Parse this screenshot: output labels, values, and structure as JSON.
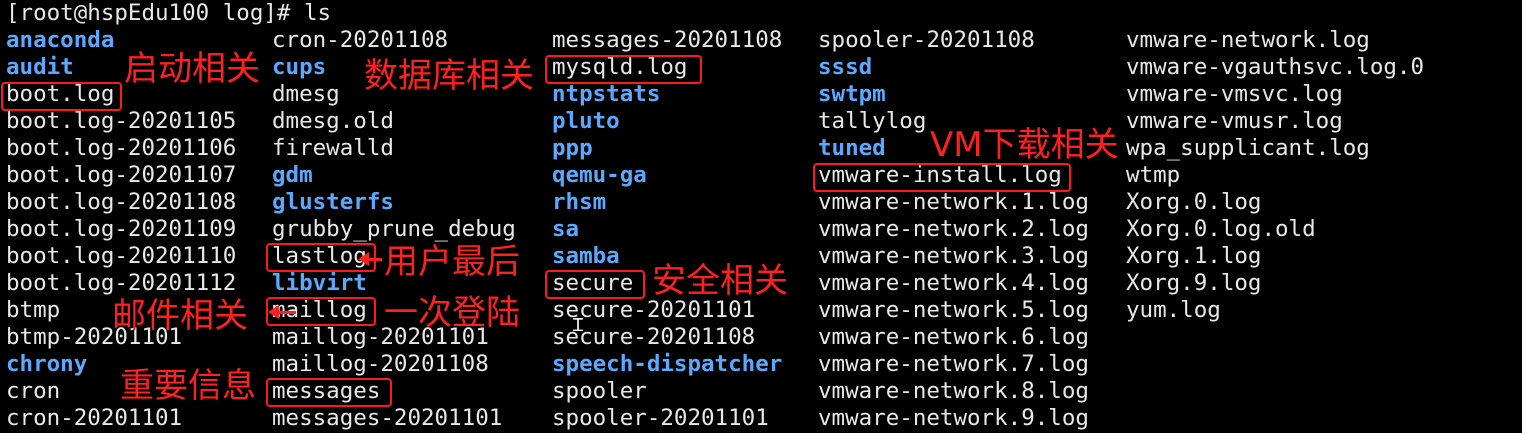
{
  "terminal": {
    "prompt": "[root@hspEdu100 log]# ls",
    "columns": [
      {
        "entries": [
          {
            "name": "anaconda",
            "type": "dir"
          },
          {
            "name": "audit",
            "type": "dir"
          },
          {
            "name": "boot.log",
            "type": "file"
          },
          {
            "name": "boot.log-20201105",
            "type": "file"
          },
          {
            "name": "boot.log-20201106",
            "type": "file"
          },
          {
            "name": "boot.log-20201107",
            "type": "file"
          },
          {
            "name": "boot.log-20201108",
            "type": "file"
          },
          {
            "name": "boot.log-20201109",
            "type": "file"
          },
          {
            "name": "boot.log-20201110",
            "type": "file"
          },
          {
            "name": "boot.log-20201112",
            "type": "file"
          },
          {
            "name": "btmp",
            "type": "file"
          },
          {
            "name": "btmp-20201101",
            "type": "file"
          },
          {
            "name": "chrony",
            "type": "dir"
          },
          {
            "name": "cron",
            "type": "file"
          },
          {
            "name": "cron-20201101",
            "type": "file"
          }
        ]
      },
      {
        "entries": [
          {
            "name": "cron-20201108",
            "type": "file"
          },
          {
            "name": "cups",
            "type": "dir"
          },
          {
            "name": "dmesg",
            "type": "file"
          },
          {
            "name": "dmesg.old",
            "type": "file"
          },
          {
            "name": "firewalld",
            "type": "file"
          },
          {
            "name": "gdm",
            "type": "dir"
          },
          {
            "name": "glusterfs",
            "type": "dir"
          },
          {
            "name": "grubby_prune_debug",
            "type": "file"
          },
          {
            "name": "lastlog",
            "type": "file"
          },
          {
            "name": "libvirt",
            "type": "dir"
          },
          {
            "name": "maillog",
            "type": "file"
          },
          {
            "name": "maillog-20201101",
            "type": "file"
          },
          {
            "name": "maillog-20201108",
            "type": "file"
          },
          {
            "name": "messages",
            "type": "file"
          },
          {
            "name": "messages-20201101",
            "type": "file"
          }
        ]
      },
      {
        "entries": [
          {
            "name": "messages-20201108",
            "type": "file"
          },
          {
            "name": "mysqld.log",
            "type": "file"
          },
          {
            "name": "ntpstats",
            "type": "dir"
          },
          {
            "name": "pluto",
            "type": "dir"
          },
          {
            "name": "ppp",
            "type": "dir"
          },
          {
            "name": "qemu-ga",
            "type": "dir"
          },
          {
            "name": "rhsm",
            "type": "dir"
          },
          {
            "name": "sa",
            "type": "dir"
          },
          {
            "name": "samba",
            "type": "dir"
          },
          {
            "name": "secure",
            "type": "file"
          },
          {
            "name": "secure-20201101",
            "type": "file"
          },
          {
            "name": "secure-20201108",
            "type": "file"
          },
          {
            "name": "speech-dispatcher",
            "type": "dir"
          },
          {
            "name": "spooler",
            "type": "file"
          },
          {
            "name": "spooler-20201101",
            "type": "file"
          }
        ]
      },
      {
        "entries": [
          {
            "name": "spooler-20201108",
            "type": "file"
          },
          {
            "name": "sssd",
            "type": "dir"
          },
          {
            "name": "swtpm",
            "type": "dir"
          },
          {
            "name": "tallylog",
            "type": "file"
          },
          {
            "name": "tuned",
            "type": "dir"
          },
          {
            "name": "vmware-install.log",
            "type": "file"
          },
          {
            "name": "vmware-network.1.log",
            "type": "file"
          },
          {
            "name": "vmware-network.2.log",
            "type": "file"
          },
          {
            "name": "vmware-network.3.log",
            "type": "file"
          },
          {
            "name": "vmware-network.4.log",
            "type": "file"
          },
          {
            "name": "vmware-network.5.log",
            "type": "file"
          },
          {
            "name": "vmware-network.6.log",
            "type": "file"
          },
          {
            "name": "vmware-network.7.log",
            "type": "file"
          },
          {
            "name": "vmware-network.8.log",
            "type": "file"
          },
          {
            "name": "vmware-network.9.log",
            "type": "file"
          }
        ]
      },
      {
        "entries": [
          {
            "name": "vmware-network.log",
            "type": "file"
          },
          {
            "name": "vmware-vgauthsvc.log.0",
            "type": "file"
          },
          {
            "name": "vmware-vmsvc.log",
            "type": "file"
          },
          {
            "name": "vmware-vmusr.log",
            "type": "file"
          },
          {
            "name": "wpa_supplicant.log",
            "type": "file"
          },
          {
            "name": "wtmp",
            "type": "file"
          },
          {
            "name": "Xorg.0.log",
            "type": "file"
          },
          {
            "name": "Xorg.0.log.old",
            "type": "file"
          },
          {
            "name": "Xorg.1.log",
            "type": "file"
          },
          {
            "name": "Xorg.9.log",
            "type": "file"
          },
          {
            "name": "yum.log",
            "type": "file"
          }
        ]
      }
    ]
  },
  "annotations": {
    "boot": "启动相关",
    "mysql": "数据库相关",
    "vm": "VM下载相关",
    "lastlog_line1": "用户最后",
    "lastlog_line2": "一次登陆",
    "secure": "安全相关",
    "mail": "邮件相关",
    "messages": "重要信息"
  },
  "colors": {
    "background": "#000000",
    "text": "#e8e8e8",
    "directory": "#5aa9ff",
    "annotation": "#ff2020"
  },
  "icons": {
    "cursor": "i-beam-cursor-icon"
  }
}
